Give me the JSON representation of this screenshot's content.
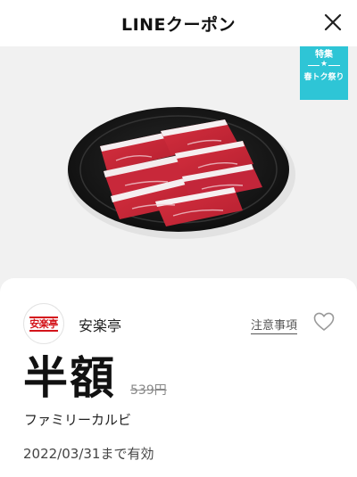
{
  "header": {
    "title": "LINEクーポン",
    "close_icon": "close-icon"
  },
  "hero": {
    "image": "grilled-beef-kalbi-on-black-plate",
    "badge": {
      "top": "特集",
      "star": "★",
      "bottom": "春トク祭り",
      "color": "#2ec5d6"
    }
  },
  "coupon": {
    "store_logo_text": "安楽亭",
    "store_name": "安楽亭",
    "notes_label": "注意事項",
    "favorite_icon": "heart-icon",
    "discount": "半額",
    "original_price": "539円",
    "product": "ファミリーカルビ",
    "validity": "2022/03/31まで有効",
    "brand_color": "#d4141b"
  }
}
